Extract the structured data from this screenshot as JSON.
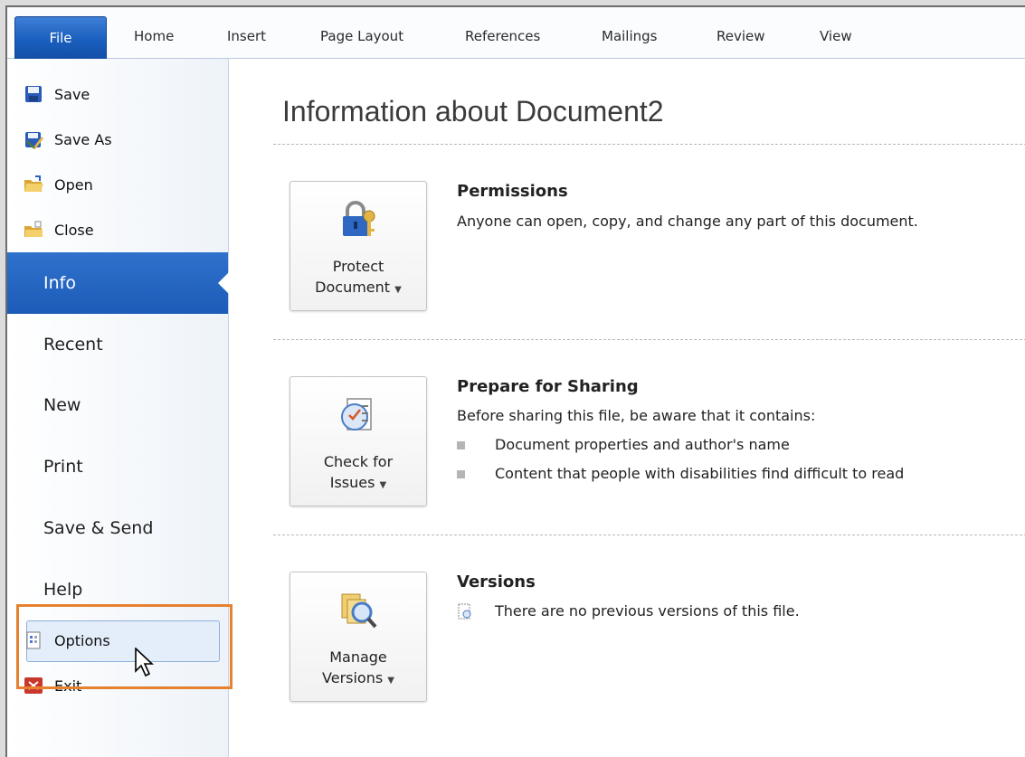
{
  "ribbon": {
    "tabs": [
      "File",
      "Home",
      "Insert",
      "Page Layout",
      "References",
      "Mailings",
      "Review",
      "View"
    ]
  },
  "backstage": {
    "commands": [
      {
        "label": "Save",
        "icon": "save-icon"
      },
      {
        "label": "Save As",
        "icon": "save-as-icon"
      },
      {
        "label": "Open",
        "icon": "open-folder-icon"
      },
      {
        "label": "Close",
        "icon": "close-folder-icon"
      }
    ],
    "nav": [
      "Info",
      "Recent",
      "New",
      "Print",
      "Save & Send",
      "Help"
    ],
    "active_nav": "Info",
    "bottom_commands": [
      {
        "label": "Options",
        "icon": "options-icon"
      },
      {
        "label": "Exit",
        "icon": "exit-icon"
      }
    ]
  },
  "info": {
    "title": "Information about Document2",
    "sections": [
      {
        "button_line1": "Protect",
        "button_line2": "Document",
        "button_icon": "lock-key-icon",
        "heading": "Permissions",
        "text": "Anyone can open, copy, and change any part of this document."
      },
      {
        "button_line1": "Check for",
        "button_line2": "Issues",
        "button_icon": "checklist-icon",
        "heading": "Prepare for Sharing",
        "text": "Before sharing this file, be aware that it contains:",
        "bullets": [
          "Document properties and author's name",
          "Content that people with disabilities find difficult to read"
        ]
      },
      {
        "button_line1": "Manage",
        "button_line2": "Versions",
        "button_icon": "versions-magnifier-icon",
        "heading": "Versions",
        "text": "There are no previous versions of this file."
      }
    ]
  },
  "colors": {
    "file_tab": "#1a5fbe",
    "active_nav": "#2467c4",
    "highlight_box": "#e6822f"
  }
}
